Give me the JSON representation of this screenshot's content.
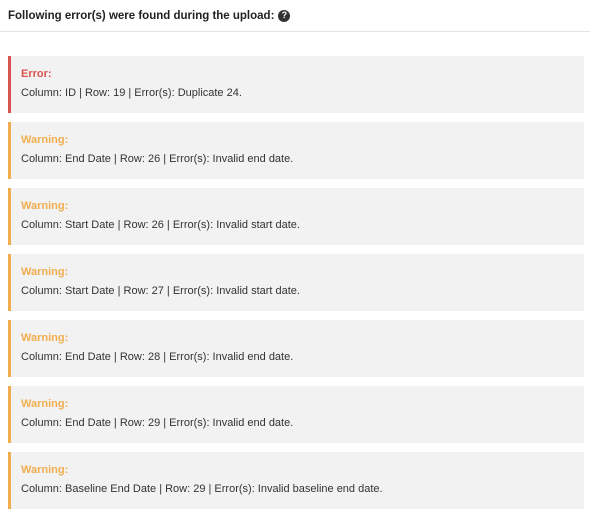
{
  "header": {
    "title": "Following error(s) were found during the upload:",
    "help_icon": "question-circle-icon"
  },
  "colors": {
    "error": "#d9534f",
    "warning": "#f0ad4e",
    "message_background": "#f2f2f2"
  },
  "messages": [
    {
      "type": "error",
      "label": "Error:",
      "text": "Column: ID | Row: 19 | Error(s): Duplicate 24."
    },
    {
      "type": "warning",
      "label": "Warning:",
      "text": "Column: End Date | Row: 26 | Error(s): Invalid end date."
    },
    {
      "type": "warning",
      "label": "Warning:",
      "text": "Column: Start Date | Row: 26 | Error(s): Invalid start date."
    },
    {
      "type": "warning",
      "label": "Warning:",
      "text": "Column: Start Date | Row: 27 | Error(s): Invalid start date."
    },
    {
      "type": "warning",
      "label": "Warning:",
      "text": "Column: End Date | Row: 28 | Error(s): Invalid end date."
    },
    {
      "type": "warning",
      "label": "Warning:",
      "text": "Column: End Date | Row: 29 | Error(s): Invalid end date."
    },
    {
      "type": "warning",
      "label": "Warning:",
      "text": "Column: Baseline End Date | Row: 29 | Error(s): Invalid baseline end date."
    }
  ]
}
